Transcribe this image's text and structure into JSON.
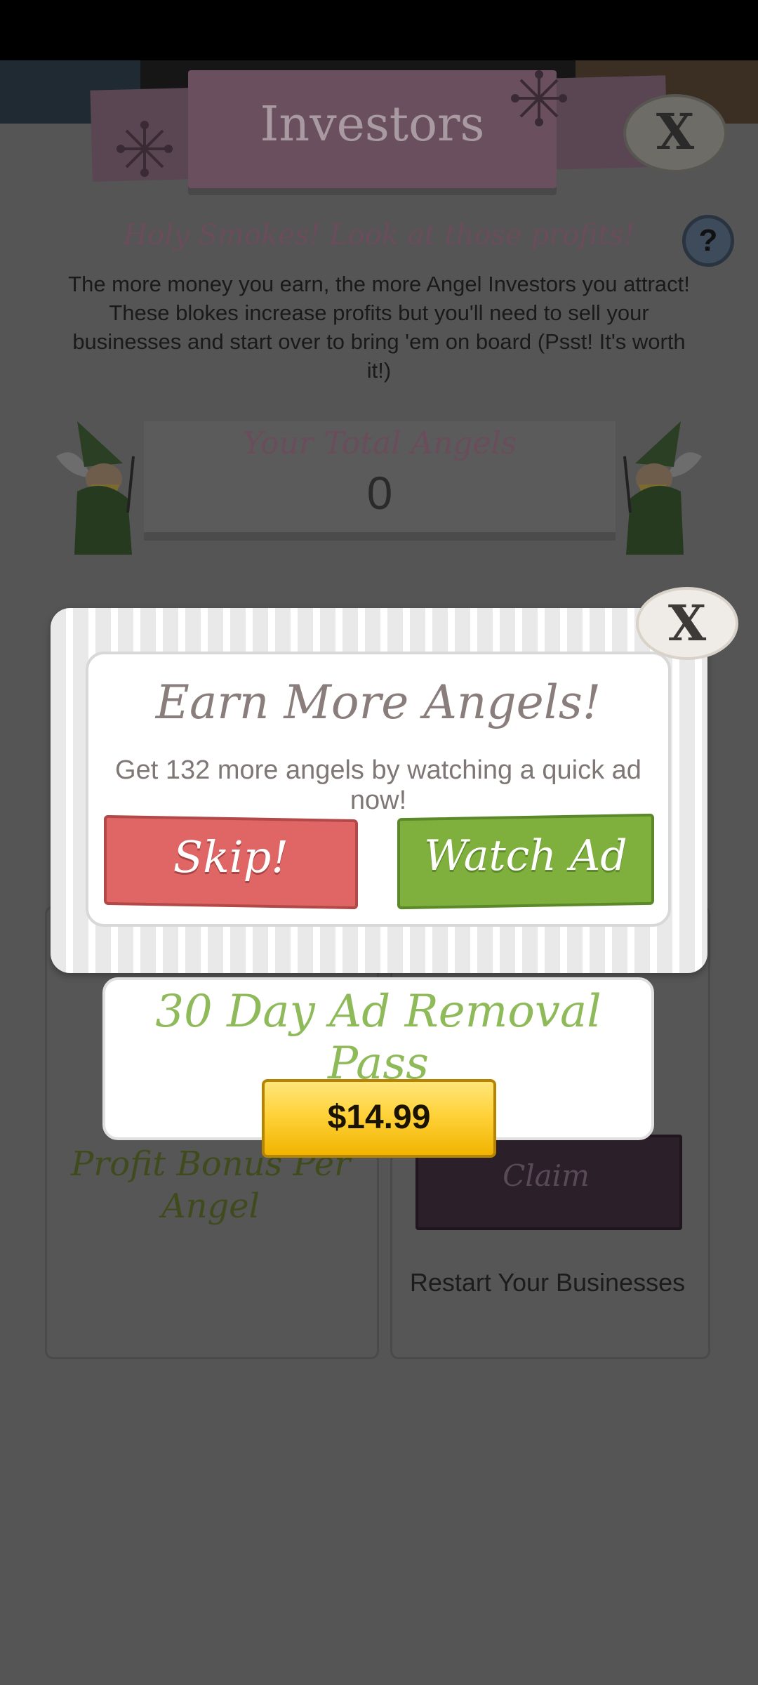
{
  "investors": {
    "title": "Investors",
    "close_label": "X",
    "subtitle": "Holy Smokes! Look at those profits!",
    "help_label": "?",
    "description": "The more money you earn, the more Angel Investors you attract! These blokes increase profits but you'll need to sell your businesses and start over to bring 'em on board (Psst! It's worth it!)",
    "total_angels_label": "Your Total Angels",
    "total_angels_value": "0",
    "profit_bonus_label": "Profit Bonus Per Angel",
    "claim_label": "Claim",
    "restart_label": "Restart Your Businesses"
  },
  "modal": {
    "title": "Earn More Angels!",
    "message": "Get 132 more angels by watching a quick ad now!",
    "skip_label": "Skip!",
    "watch_label": "Watch Ad",
    "close_label": "X"
  },
  "ad_removal": {
    "title": "30 Day Ad Removal Pass",
    "price": "$14.99"
  },
  "colors": {
    "skip": "#e06666",
    "watch": "#7fb03d",
    "price": "#ffd23a",
    "pass_title": "#8fba5a"
  }
}
